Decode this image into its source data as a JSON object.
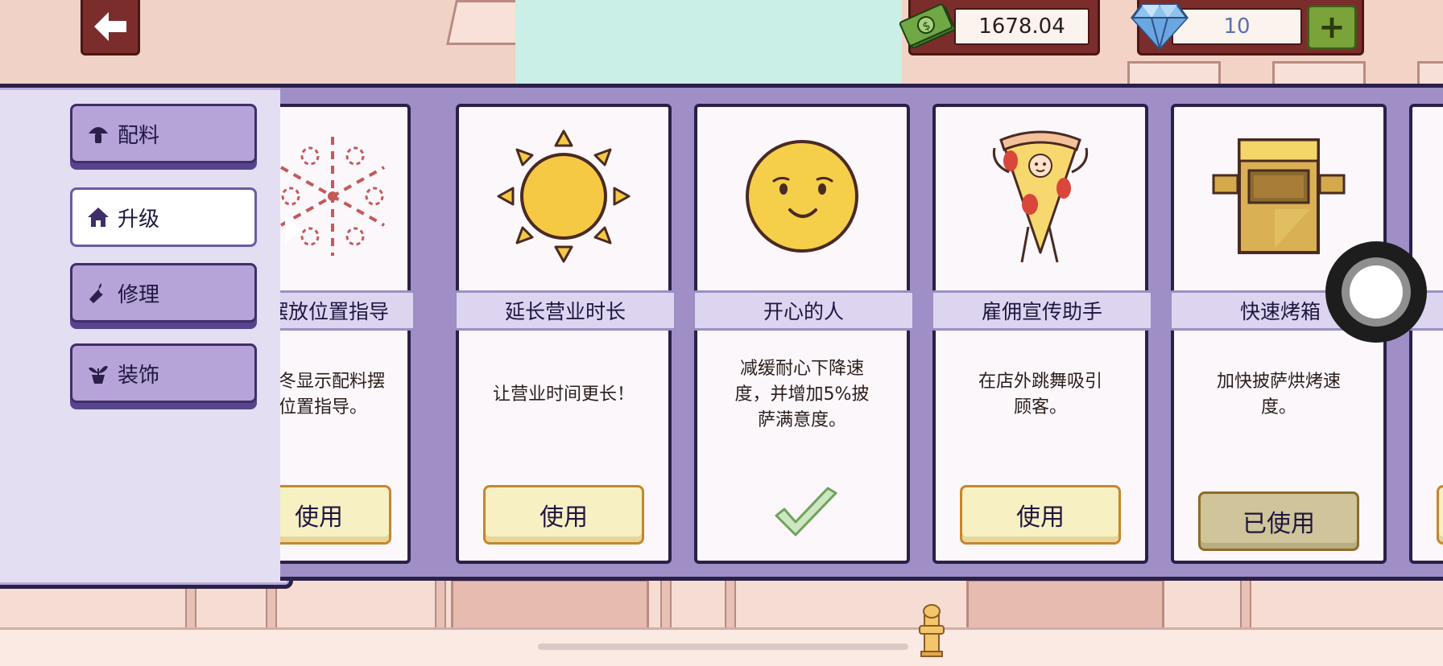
{
  "hud": {
    "money": "1678.04",
    "gems": "10",
    "plus_label": "+"
  },
  "menu": {
    "items": [
      {
        "label": "配料",
        "icon": "mushroom-icon"
      },
      {
        "label": "升级",
        "icon": "house-icon",
        "active": true
      },
      {
        "label": "修理",
        "icon": "wrench-icon"
      },
      {
        "label": "装饰",
        "icon": "plant-icon"
      }
    ]
  },
  "cards": [
    {
      "title": "摆放位置指导",
      "desc": "终显示配料摆位置指导。",
      "desc_lines": [
        "冬显示配料摆",
        "位置指导。"
      ],
      "button": "使用",
      "state": "available",
      "icon": "snowflake-guide-icon"
    },
    {
      "title": "延长营业时长",
      "desc_lines": [
        "让营业时间更长！"
      ],
      "button": "使用",
      "state": "available",
      "icon": "sun-icon"
    },
    {
      "title": "开心的人",
      "desc_lines": [
        "减缓耐心下降速",
        "度，并增加5%披",
        "萨满意度。"
      ],
      "button": "",
      "state": "active",
      "icon": "smiley-face-icon"
    },
    {
      "title": "雇佣宣传助手",
      "desc_lines": [
        "在店外跳舞吸引",
        "顾客。"
      ],
      "button": "使用",
      "state": "available",
      "icon": "pizza-mascot-icon"
    },
    {
      "title": "快速烤箱",
      "desc_lines": [
        "加快披萨烘烤速",
        "度。"
      ],
      "button": "已使用",
      "state": "used",
      "icon": "oven-icon"
    }
  ],
  "colors": {
    "panel": "#e4def2",
    "strip": "#9f8fc6",
    "outline": "#2b2048",
    "button": "#f7f0c2",
    "button_border": "#c6862d",
    "header": "#7b2d2b",
    "plus": "#7aa33a"
  }
}
